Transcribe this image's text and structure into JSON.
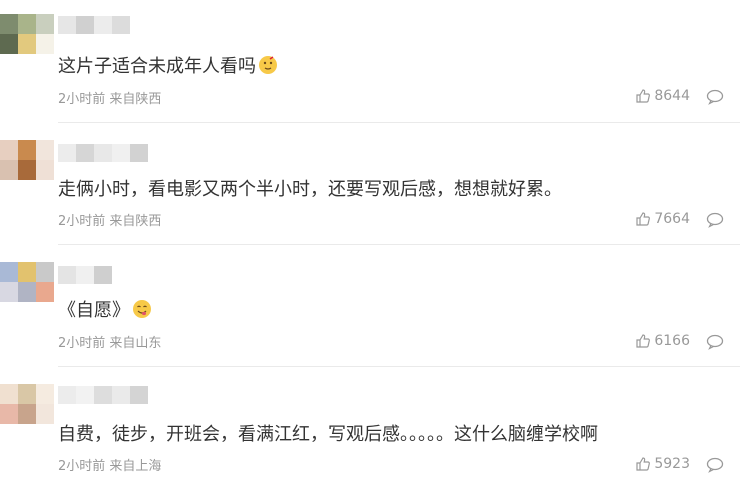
{
  "comments": [
    {
      "text": "这片子适合未成年人看吗",
      "emoji": "thinking-emoji",
      "time": "2小时前",
      "location": "来自陕西",
      "likes": "8644",
      "avatar_colors": [
        "#7e8c6e",
        "#a9b48a",
        "#c9cfbe",
        "#5e6a50",
        "#e2c97e",
        "#f5f2e8"
      ]
    },
    {
      "text": "走俩小时，看电影又两个半小时，还要写观后感，想想就好累。",
      "time": "2小时前",
      "location": "来自陕西",
      "likes": "7664",
      "avatar_colors": [
        "#e7cfc0",
        "#c98a4e",
        "#f1e5dc",
        "#d9c1b0",
        "#a86a3a",
        "#efe0d6"
      ]
    },
    {
      "text": "《自愿》",
      "emoji": "yum-emoji",
      "time": "2小时前",
      "location": "来自山东",
      "likes": "6166",
      "avatar_colors": [
        "#a9b9d6",
        "#e2c26e",
        "#c9c9c9",
        "#d8d8e2",
        "#b0b4c4",
        "#e9a88e"
      ]
    },
    {
      "text": "自费，徒步，开班会，看满江红，写观后感。。。。。这什么脑缠学校啊",
      "time": "2小时前",
      "location": "来自上海",
      "likes": "5923",
      "avatar_colors": [
        "#f0e0d0",
        "#d9c7a6",
        "#f5ebe0",
        "#e8b8a8",
        "#c8a48c",
        "#f2e6dc"
      ]
    }
  ],
  "colors": {
    "text": "#333333",
    "meta": "#999999",
    "divider": "#eaeaea",
    "emoji": "#f7c948"
  },
  "icons": {
    "like": "thumbs-up-icon",
    "reply": "reply-bubble-icon"
  }
}
